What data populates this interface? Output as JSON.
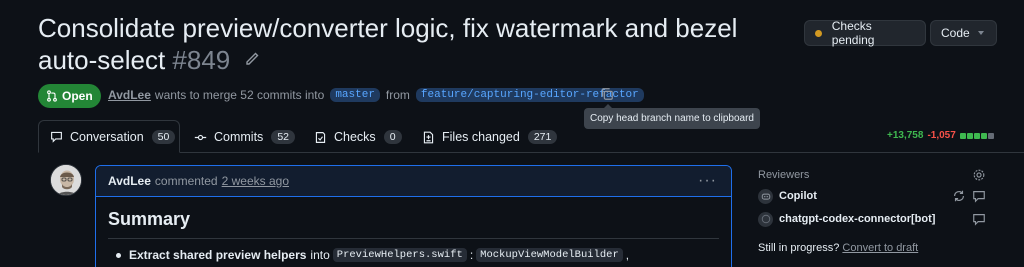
{
  "pr": {
    "title": "Consolidate preview/converter logic, fix watermark and bezel auto-select",
    "number": "#849",
    "state": "Open",
    "author": "AvdLee",
    "merge_text": "wants to merge 52 commits into",
    "base_branch": "master",
    "from_text": "from",
    "head_branch": "feature/capturing-editor-refactor"
  },
  "header_buttons": {
    "checks_label": "Checks pending",
    "code_label": "Code"
  },
  "tooltip": "Copy head branch name to clipboard",
  "tabs": [
    {
      "label": "Conversation",
      "count": "50"
    },
    {
      "label": "Commits",
      "count": "52"
    },
    {
      "label": "Checks",
      "count": "0"
    },
    {
      "label": "Files changed",
      "count": "271"
    }
  ],
  "diffstat": {
    "additions": "+13,758",
    "deletions": "-1,057"
  },
  "comment": {
    "author": "AvdLee",
    "action": "commented",
    "time": "2 weeks ago",
    "heading": "Summary",
    "bullet_bold": "Extract shared preview helpers",
    "bullet_into": "into",
    "code1": "PreviewHelpers.swift",
    "colon": ":",
    "code2": "MockupViewModelBuilder",
    "comma": ","
  },
  "sidebar": {
    "reviewers_label": "Reviewers",
    "reviewers": [
      {
        "name": "Copilot"
      },
      {
        "name": "chatgpt-codex-connector[bot]"
      }
    ],
    "still_text": "Still in progress?",
    "convert_link": "Convert to draft"
  },
  "colors": {
    "background": "#0d1117",
    "open_badge": "#238636",
    "link_blue": "#58a6ff",
    "additions": "#3fb950",
    "deletions": "#f85149",
    "pending_dot": "#d29922"
  }
}
